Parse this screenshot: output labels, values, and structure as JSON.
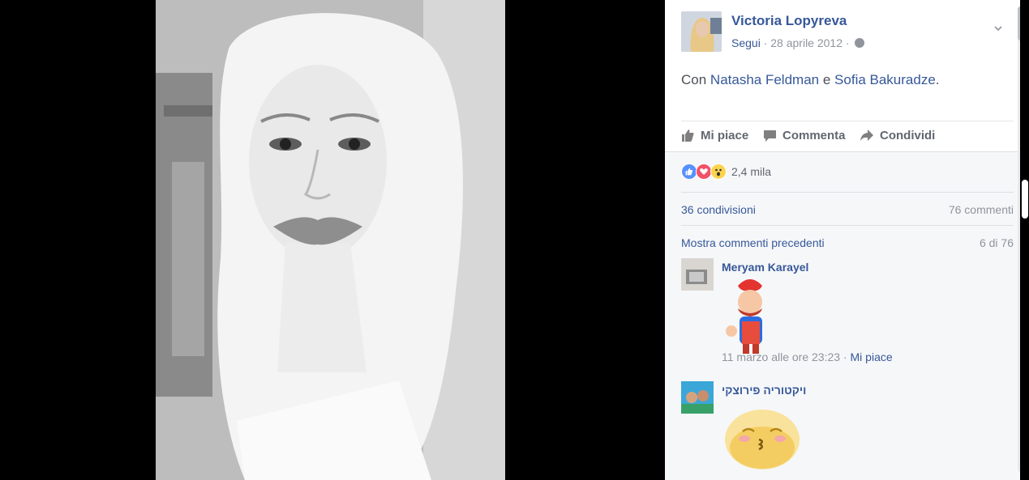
{
  "post": {
    "author": "Victoria Lopyreva",
    "follow": "Segui",
    "date": "28 aprile 2012",
    "with_prefix": "Con",
    "tag1": "Natasha Feldman",
    "with_and": "e",
    "tag2": "Sofia Bakuradze",
    "with_suffix": "."
  },
  "actions": {
    "like": "Mi piace",
    "comment": "Commenta",
    "share": "Condividi"
  },
  "stats": {
    "reactions": "2,4 mila",
    "shares": "36 condivisioni",
    "comments": "76 commenti"
  },
  "comments_section": {
    "previous": "Mostra commenti precedenti",
    "pager": "6 di 76"
  },
  "comments": [
    {
      "name": "Meryam Karayel",
      "time": "11 marzo alle ore 23:23",
      "like": "Mi piace"
    },
    {
      "name": "ויקטוריה פירוצקי"
    }
  ],
  "icons": {
    "reactions": [
      "like-reaction-icon",
      "love-reaction-icon",
      "wow-reaction-icon"
    ],
    "privacy": "globe-icon"
  },
  "colors": {
    "link": "#365899",
    "meta": "#90949c",
    "like_blue": "#5890ff",
    "love_red": "#f25268"
  }
}
